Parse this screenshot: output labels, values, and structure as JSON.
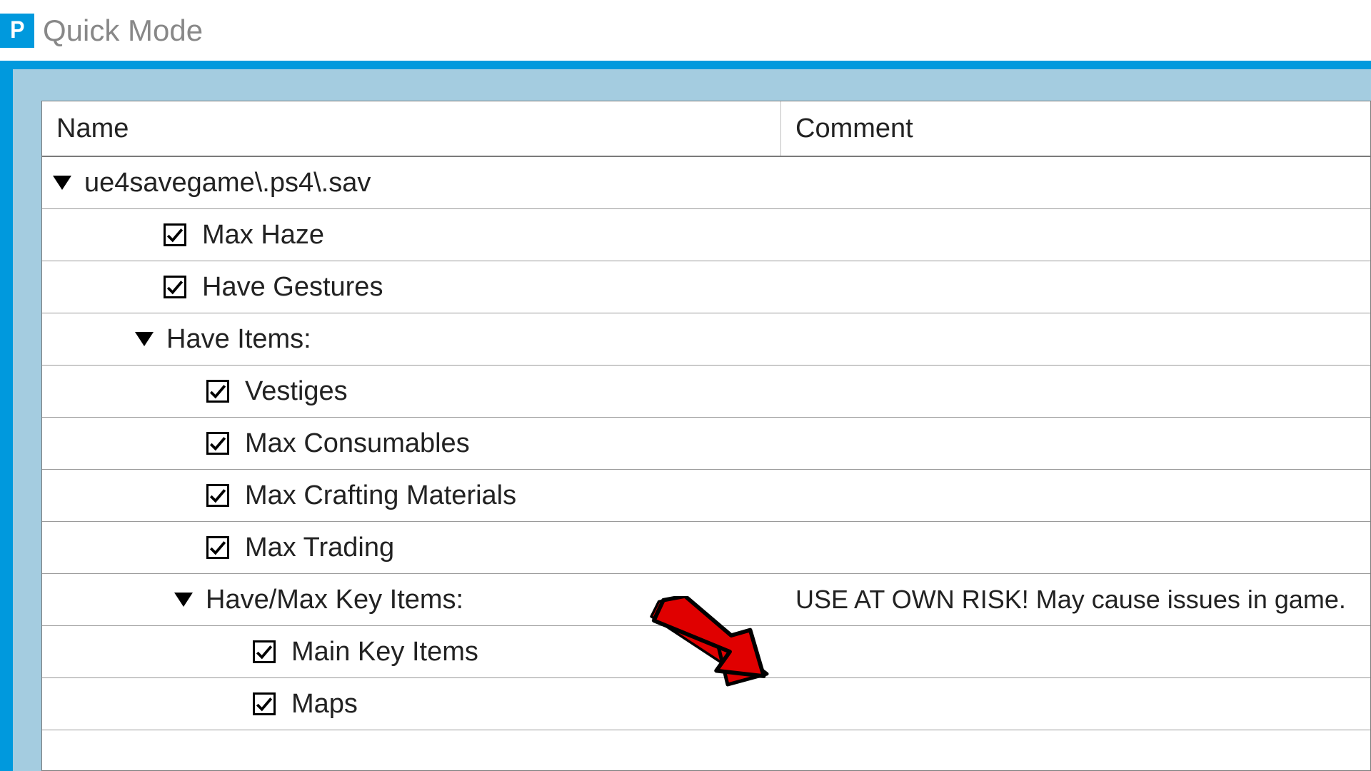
{
  "title": "Quick Mode",
  "columns": {
    "name": "Name",
    "comment": "Comment"
  },
  "tree": {
    "root": {
      "label": "ue4savegame\\.ps4\\.sav"
    },
    "items": [
      {
        "label": "Max Haze"
      },
      {
        "label": "Have Gestures"
      }
    ],
    "have_items": {
      "label": "Have Items:",
      "children": [
        {
          "label": "Vestiges"
        },
        {
          "label": "Max Consumables"
        },
        {
          "label": "Max Crafting Materials"
        },
        {
          "label": "Max Trading"
        }
      ],
      "key_items": {
        "label": "Have/Max Key Items:",
        "comment": "USE AT OWN RISK! May cause issues in game.",
        "children": [
          {
            "label": "Main Key Items"
          },
          {
            "label": "Maps"
          }
        ]
      }
    }
  }
}
